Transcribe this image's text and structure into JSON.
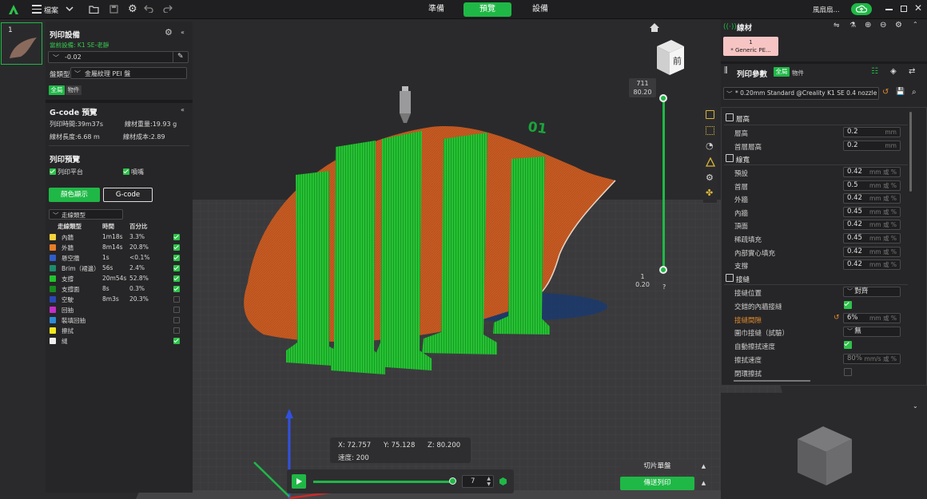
{
  "topbar": {
    "file_menu": "檔案",
    "tabs": [
      "準備",
      "預覽",
      "設備"
    ],
    "active_tab": 1,
    "user_name": "風扇扇..."
  },
  "plate": {
    "number": "1"
  },
  "printer": {
    "title": "列印設備",
    "current_device": "當前設備: K1 SE-老靜",
    "value_field": "-0.02",
    "plate_type_label": "盤類型",
    "plate_type_value": "金屬紋理 PEI 盤",
    "toggle_global": "全局",
    "toggle_object": "物件"
  },
  "gcode_preview": {
    "title": "G-code 預覽",
    "print_time": "列印時間:39m37s",
    "filament_weight": "線材重量:19.93 g",
    "filament_length": "線材長度:6.68 m",
    "filament_cost": "線材成本:2.89"
  },
  "print_preview": {
    "title": "列印預覽",
    "opt_plate": "列印平台",
    "opt_nozzle": "噴嘴",
    "btn_color": "顏色顯示",
    "btn_gcode": "G-code",
    "line_type_select": "走線類型",
    "col_type": "走線類型",
    "col_time": "時間",
    "col_percent": "百分比",
    "rows": [
      {
        "name": "內牆",
        "time": "1m18s",
        "pct": "3.3%",
        "color": "#f5d23b",
        "on": true
      },
      {
        "name": "外牆",
        "time": "8m14s",
        "pct": "20.8%",
        "color": "#e87c28",
        "on": true
      },
      {
        "name": "懸空牆",
        "time": "1s",
        "pct": "<0.1%",
        "color": "#2f5ec9",
        "on": true
      },
      {
        "name": "Brim（裙邊）",
        "time": "56s",
        "pct": "2.4%",
        "color": "#1e8c6e",
        "on": true
      },
      {
        "name": "支撐",
        "time": "20m54s",
        "pct": "52.8%",
        "color": "#22c32e",
        "on": true
      },
      {
        "name": "支撐面",
        "time": "8s",
        "pct": "0.3%",
        "color": "#178a1e",
        "on": true
      },
      {
        "name": "空駛",
        "time": "8m3s",
        "pct": "20.3%",
        "color": "#2a47b8",
        "on": false
      },
      {
        "name": "回抽",
        "time": "",
        "pct": "",
        "color": "#c42ec9",
        "on": false
      },
      {
        "name": "裝填回抽",
        "time": "",
        "pct": "",
        "color": "#2e8bd6",
        "on": false
      },
      {
        "name": "擦拭",
        "time": "",
        "pct": "",
        "color": "#f5e81e",
        "on": false
      },
      {
        "name": "縫",
        "time": "",
        "pct": "",
        "color": "#f0f0f0",
        "on": true
      }
    ]
  },
  "viewport": {
    "layer_top": "711",
    "height_top": "80.20",
    "layer_bottom": "1",
    "height_bottom": "0.20",
    "help": "?",
    "cube_label": "前",
    "plate_label": "01",
    "coord_x": "X: 72.757",
    "coord_y": "Y: 75.128",
    "coord_z": "Z: 80.200",
    "speed": "速度:  200",
    "move_value": "7",
    "btn_slice": "切片單盤",
    "btn_send": "傳送列印"
  },
  "filament": {
    "title": "線材",
    "slot_number": "1",
    "slot_name": "* Generic PE...",
    "slot_color": "#f7c4c4"
  },
  "params": {
    "title": "列印參數",
    "toggle_global": "全局",
    "toggle_object": "物件",
    "preset": "* 0.20mm  Standard @Creality K1 SE 0.4 nozzle",
    "section_layer": "層高",
    "layer_rows": [
      {
        "label": "層高",
        "value": "0.2",
        "unit": "mm"
      },
      {
        "label": "首層層高",
        "value": "0.2",
        "unit": "mm"
      }
    ],
    "section_width": "線寬",
    "width_rows": [
      {
        "label": "預設",
        "value": "0.42",
        "unit": "mm 或 %"
      },
      {
        "label": "首層",
        "value": "0.5",
        "unit": "mm 或 %"
      },
      {
        "label": "外牆",
        "value": "0.42",
        "unit": "mm 或 %"
      },
      {
        "label": "內牆",
        "value": "0.45",
        "unit": "mm 或 %"
      },
      {
        "label": "頂面",
        "value": "0.42",
        "unit": "mm 或 %"
      },
      {
        "label": "稀疏填充",
        "value": "0.45",
        "unit": "mm 或 %"
      },
      {
        "label": "內部實心填充",
        "value": "0.42",
        "unit": "mm 或 %"
      },
      {
        "label": "支撐",
        "value": "0.42",
        "unit": "mm 或 %"
      }
    ],
    "section_seam": "接縫",
    "seam_position_label": "接縫位置",
    "seam_position_value": "對齊",
    "staggered_label": "交錯的內牆接縫",
    "seam_gap_label": "接縫間隙",
    "seam_gap_value": "6%",
    "seam_gap_unit": "mm 或 %",
    "scarf_label": "圍巾接縫（試驗）",
    "scarf_value": "無",
    "auto_wipe_label": "自動擦拭速度",
    "wipe_speed_label": "擦拭速度",
    "wipe_speed_value": "80%",
    "wipe_speed_unit": "mm/s 或 %",
    "wipe_on_loop_label": "閉環擦拭"
  }
}
